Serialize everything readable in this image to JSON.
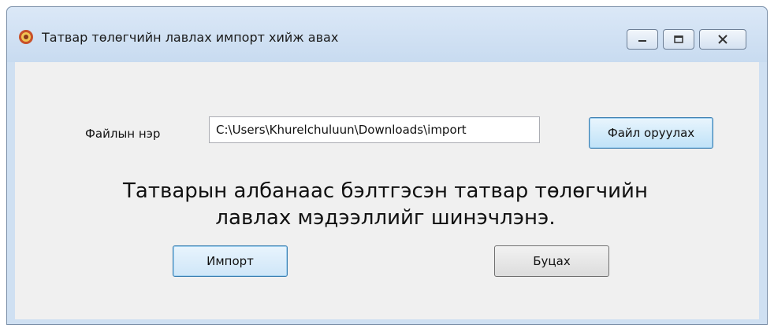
{
  "window": {
    "title": "Татвар төлөгчийн лавлах импорт хийж авах",
    "controls": {
      "minimize_icon": "minimize-icon",
      "maximize_icon": "maximize-icon",
      "close_icon": "close-icon"
    }
  },
  "form": {
    "file_label": "Файлын нэр",
    "file_path": "C:\\Users\\Khurelchuluun\\Downloads\\import",
    "upload_button": "Файл оруулах",
    "message": "Татварын албанаас бэлтгэсэн татвар төлөгчийн лавлах мэдээллийг шинэчлэнэ.",
    "import_button": "Импорт",
    "back_button": "Буцах"
  },
  "colors": {
    "accent_border": "#3c7fb1",
    "window_frame": "#cfe0f2",
    "client_bg": "#f0f0f0"
  }
}
